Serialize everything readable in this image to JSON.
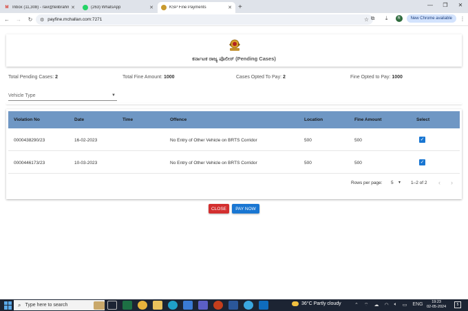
{
  "browser": {
    "tabs": [
      {
        "label": "Inbox (11,308) - ravi@telibrahm…",
        "icon": "gmail-icon",
        "active": false
      },
      {
        "label": "(263) WhatsApp",
        "icon": "whatsapp-icon",
        "active": false
      },
      {
        "label": "KSP Fine Payments",
        "icon": "ksp-emblem-icon",
        "active": true
      }
    ],
    "url": "payfine.mchallan.com:7271",
    "new_chrome_label": "New Chrome available",
    "profile_initial": "R"
  },
  "page": {
    "title": "ಕರ್ನಾಟಕ ರಾಜ್ಯ ಪೊಲೀಸ್ (Pending Cases)",
    "summary": {
      "total_pending_label": "Total Pending Cases:",
      "total_pending_value": "2",
      "total_fine_label": "Total Fine Amount:",
      "total_fine_value": "1000",
      "opted_label": "Cases Opted To Pay:",
      "opted_value": "2",
      "fine_opted_label": "Fine Opted to Pay:",
      "fine_opted_value": "1000"
    },
    "vehicle_type_label": "Vehicle Type",
    "table": {
      "headers": {
        "violation_no": "Violation No",
        "date": "Date",
        "time": "Time",
        "offence": "Offence",
        "location": "Location",
        "fine_amount": "Fine Amount",
        "select": "Select"
      },
      "rows": [
        {
          "violation_no": "0000438290/23",
          "date": "16-02-2023",
          "time": "",
          "offence": "No Entry of Other Vehicle on BRTS Corridor",
          "location": "500",
          "fine_amount": "500",
          "selected": true
        },
        {
          "violation_no": "0000446173/23",
          "date": "10-03-2023",
          "time": "",
          "offence": "No Entry of Other Vehicle on BRTS Corridor",
          "location": "500",
          "fine_amount": "500",
          "selected": true
        }
      ],
      "rows_per_page_label": "Rows per page:",
      "rows_per_page_value": "5",
      "range_label": "1–2 of 2"
    },
    "buttons": {
      "close": "CLOSE",
      "pay_now": "PAY NOW"
    }
  },
  "taskbar": {
    "search_placeholder": "Type here to search",
    "weather": "36°C  Partly cloudy",
    "language": "ENG",
    "time": "19:23",
    "date": "02-05-2024",
    "notification_count": "5"
  },
  "colors": {
    "table_header": "#6f97c4",
    "close_button": "#d32f2f",
    "pay_button": "#1976d2",
    "checkbox": "#1976d2",
    "taskbar": "#1c2433"
  }
}
